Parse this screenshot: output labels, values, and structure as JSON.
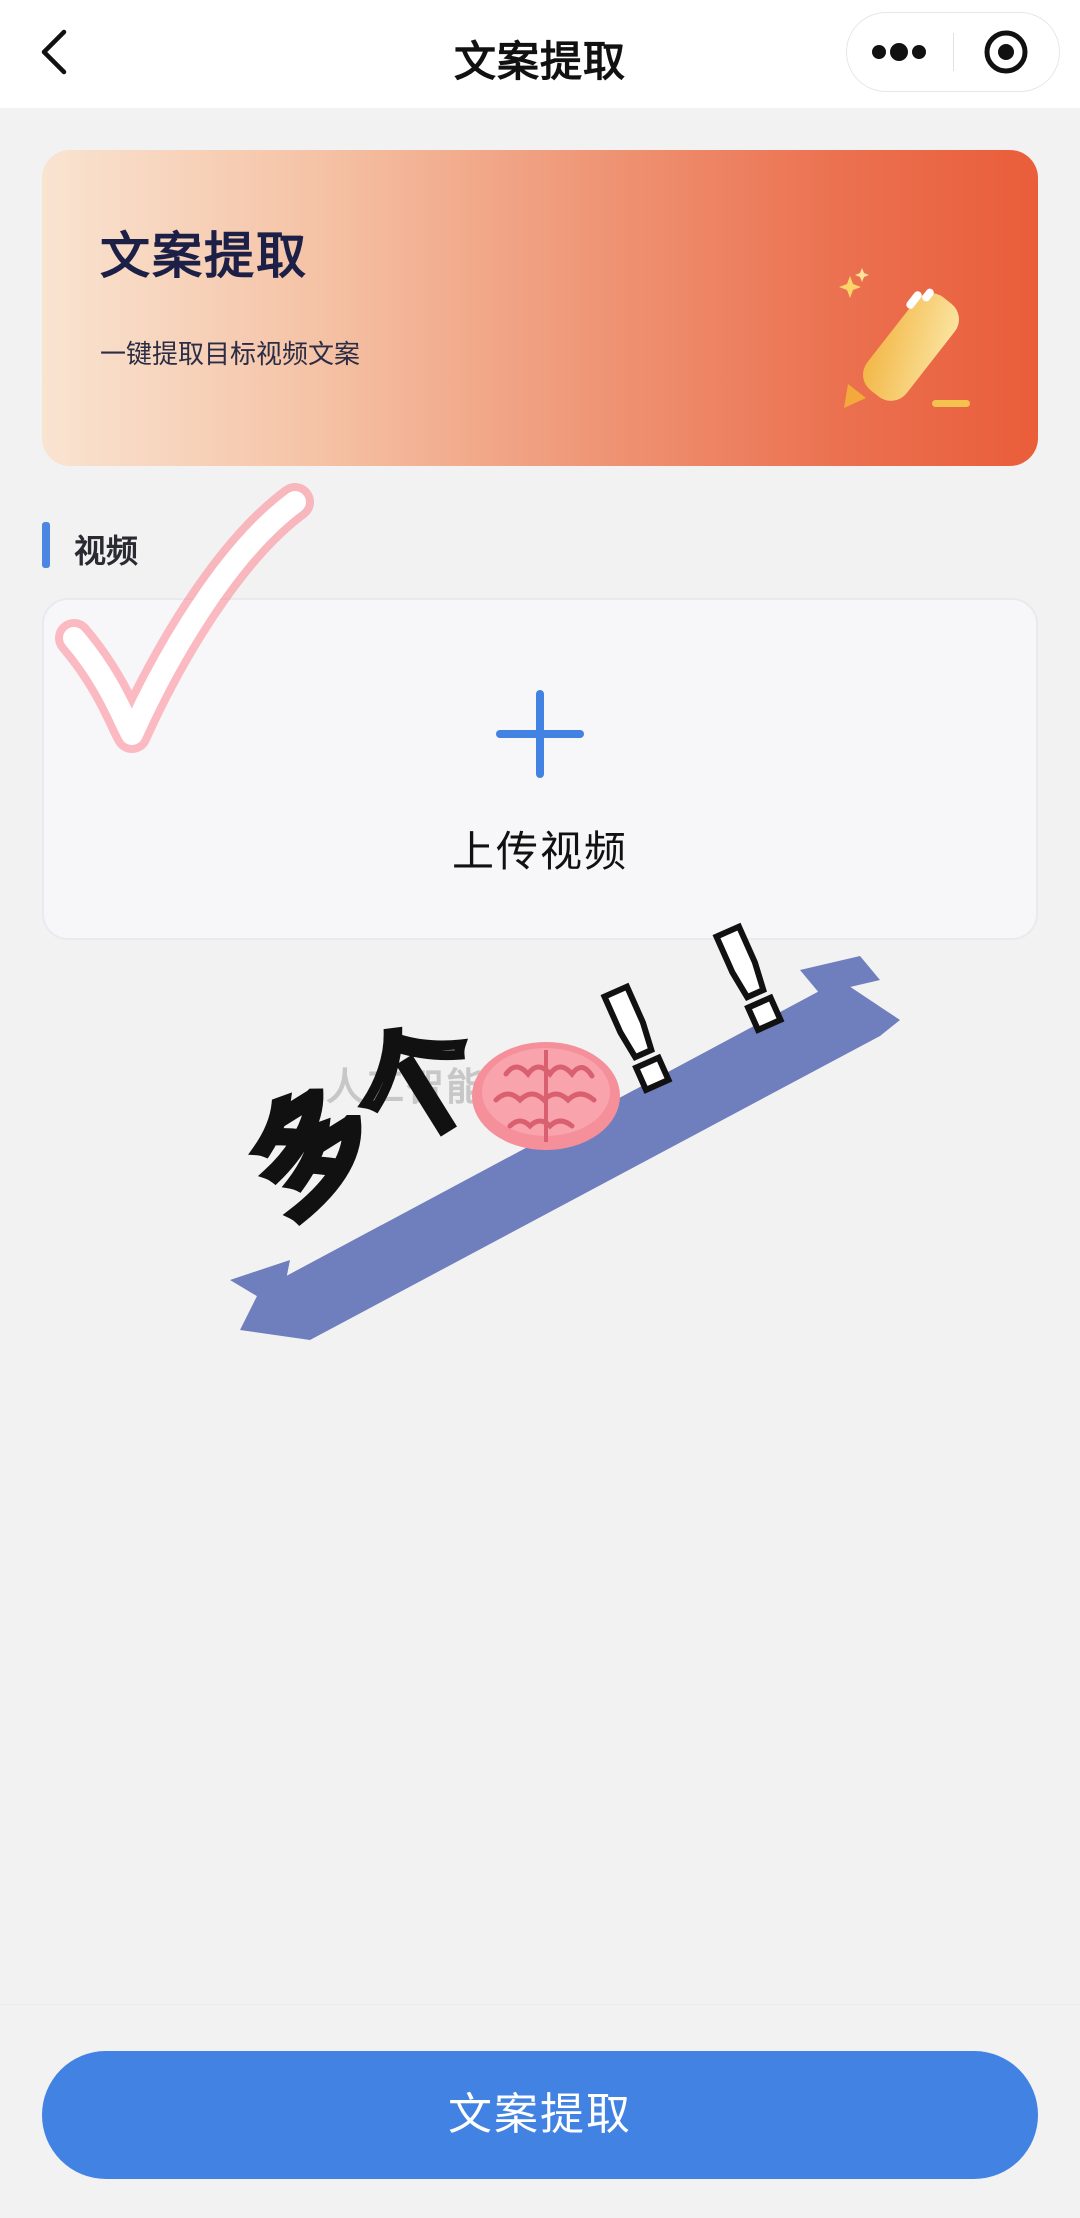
{
  "header": {
    "title": "文案提取",
    "back_icon": "chevron-left-icon",
    "more_icon": "more-dots-icon",
    "close_icon": "record-circle-icon"
  },
  "banner": {
    "title": "文案提取",
    "subtitle": "一键提取目标视频文案",
    "icon": "pencil-icon",
    "gradient_colors": [
      "#f9e4d1",
      "#ea5d3a"
    ]
  },
  "section": {
    "label": "视频",
    "accent_color": "#4a86e2"
  },
  "upload": {
    "icon": "plus-icon",
    "label": "上传视频"
  },
  "overlay": {
    "watermark": "人工智能",
    "sticker_text": "多个",
    "exclamations": [
      "!",
      "!"
    ],
    "brush_color": "#6f7fbd"
  },
  "footer": {
    "submit_label": "文案提取",
    "button_color": "#4182e3"
  }
}
